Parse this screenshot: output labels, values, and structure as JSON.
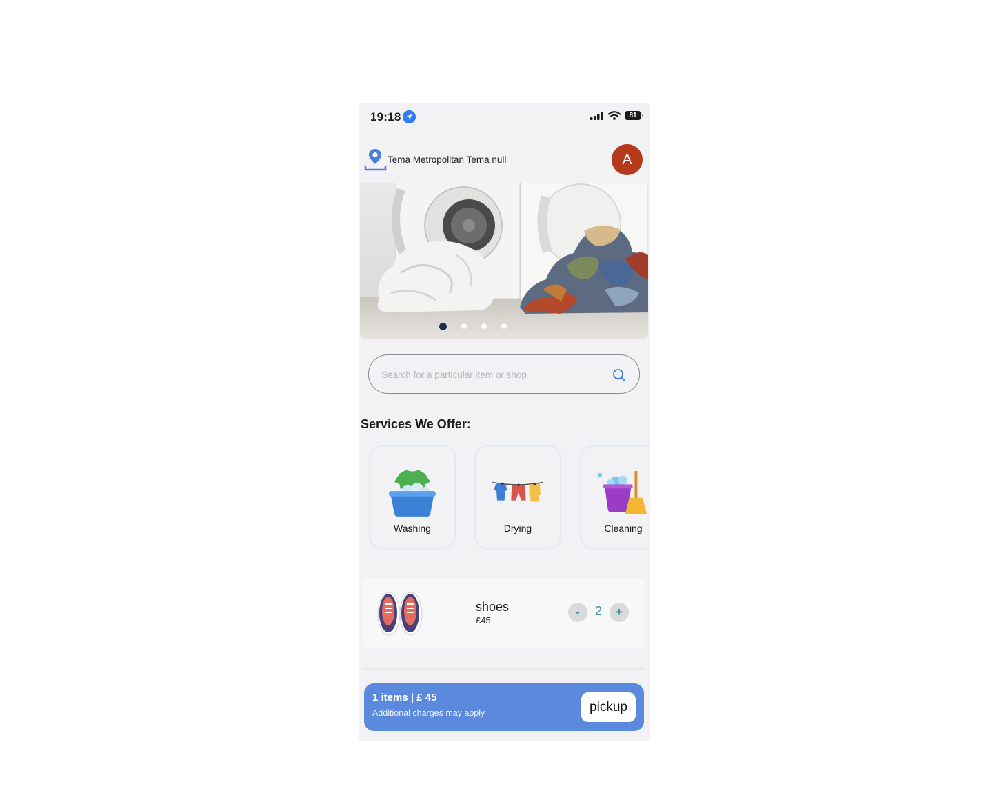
{
  "status_bar": {
    "time": "19:18",
    "battery": "81"
  },
  "header": {
    "location": "Tema Metropolitan Tema null",
    "avatar_initial": "A"
  },
  "banner": {
    "slide_count": 4,
    "active_slide": 1
  },
  "search": {
    "placeholder": "Search for a particular item or shop"
  },
  "services": {
    "title": "Services We Offer:",
    "items": [
      {
        "label": "Washing",
        "icon": "washing-basin-icon"
      },
      {
        "label": "Drying",
        "icon": "clothesline-icon"
      },
      {
        "label": "Cleaning",
        "icon": "bucket-broom-icon"
      }
    ]
  },
  "cart_item": {
    "name": "shoes",
    "price": "£45",
    "quantity": "2",
    "minus": "-",
    "plus": "+"
  },
  "checkout": {
    "summary": "1 items | £ 45",
    "note": "Additional charges may apply",
    "button": "pickup"
  },
  "colors": {
    "accent": "#5b89de",
    "avatar": "#b53a1c",
    "qty": "#3f8f99"
  }
}
